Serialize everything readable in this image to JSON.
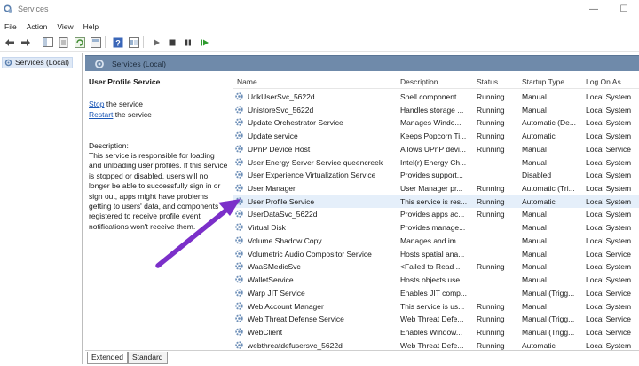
{
  "window": {
    "title": "Services",
    "minimize": "—",
    "restore": "☐"
  },
  "menu": [
    "File",
    "Action",
    "View",
    "Help"
  ],
  "toolbar_icons": [
    "back-icon",
    "forward-icon",
    "show-hide-console-tree-icon",
    "properties-icon",
    "refresh-icon",
    "export-list-icon",
    "help-icon",
    "view-icon",
    "start-icon",
    "stop-icon",
    "pause-icon",
    "restart-icon"
  ],
  "tree": {
    "root": "Services (Local)"
  },
  "header": {
    "title": "Services (Local)"
  },
  "details": {
    "service_name": "User Profile Service",
    "stop_link": "Stop",
    "stop_suffix": " the service",
    "restart_link": "Restart",
    "restart_suffix": " the service",
    "description_label": "Description:",
    "description": "This service is responsible for loading and unloading user profiles. If this service is stopped or disabled, users will no longer be able to successfully sign in or sign out, apps might have problems getting to users' data, and components registered to receive profile event notifications won't receive them."
  },
  "columns": [
    "Name",
    "Description",
    "Status",
    "Startup Type",
    "Log On As"
  ],
  "rows": [
    {
      "name": "UdkUserSvc_5622d",
      "description": "Shell component...",
      "status": "Running",
      "startup": "Manual",
      "logon": "Local System"
    },
    {
      "name": "UnistoreSvc_5622d",
      "description": "Handles storage ...",
      "status": "Running",
      "startup": "Manual",
      "logon": "Local System"
    },
    {
      "name": "Update Orchestrator Service",
      "description": "Manages Windo...",
      "status": "Running",
      "startup": "Automatic (De...",
      "logon": "Local System"
    },
    {
      "name": "Update service",
      "description": "Keeps Popcorn Ti...",
      "status": "Running",
      "startup": "Automatic",
      "logon": "Local System"
    },
    {
      "name": "UPnP Device Host",
      "description": "Allows UPnP devi...",
      "status": "Running",
      "startup": "Manual",
      "logon": "Local Service"
    },
    {
      "name": "User Energy Server Service queencreek",
      "description": "Intel(r) Energy Ch...",
      "status": "",
      "startup": "Manual",
      "logon": "Local System"
    },
    {
      "name": "User Experience Virtualization Service",
      "description": "Provides support...",
      "status": "",
      "startup": "Disabled",
      "logon": "Local System"
    },
    {
      "name": "User Manager",
      "description": "User Manager pr...",
      "status": "Running",
      "startup": "Automatic (Tri...",
      "logon": "Local System"
    },
    {
      "name": "User Profile Service",
      "description": "This service is res...",
      "status": "Running",
      "startup": "Automatic",
      "logon": "Local System"
    },
    {
      "name": "UserDataSvc_5622d",
      "description": "Provides apps ac...",
      "status": "Running",
      "startup": "Manual",
      "logon": "Local System"
    },
    {
      "name": "Virtual Disk",
      "description": "Provides manage...",
      "status": "",
      "startup": "Manual",
      "logon": "Local System"
    },
    {
      "name": "Volume Shadow Copy",
      "description": "Manages and im...",
      "status": "",
      "startup": "Manual",
      "logon": "Local System"
    },
    {
      "name": "Volumetric Audio Compositor Service",
      "description": "Hosts spatial ana...",
      "status": "",
      "startup": "Manual",
      "logon": "Local Service"
    },
    {
      "name": "WaaSMedicSvc",
      "description": "<Failed to Read ...",
      "status": "Running",
      "startup": "Manual",
      "logon": "Local System"
    },
    {
      "name": "WalletService",
      "description": "Hosts objects use...",
      "status": "",
      "startup": "Manual",
      "logon": "Local System"
    },
    {
      "name": "Warp JIT Service",
      "description": "Enables JIT comp...",
      "status": "",
      "startup": "Manual (Trigg...",
      "logon": "Local Service"
    },
    {
      "name": "Web Account Manager",
      "description": "This service is us...",
      "status": "Running",
      "startup": "Manual",
      "logon": "Local System"
    },
    {
      "name": "Web Threat Defense Service",
      "description": "Web Threat Defe...",
      "status": "Running",
      "startup": "Manual (Trigg...",
      "logon": "Local Service"
    },
    {
      "name": "WebClient",
      "description": "Enables Window...",
      "status": "Running",
      "startup": "Manual (Trigg...",
      "logon": "Local Service"
    },
    {
      "name": "webthreatdefusersvc_5622d",
      "description": "Web Threat Defe...",
      "status": "Running",
      "startup": "Automatic",
      "logon": "Local System"
    }
  ],
  "selected_row": "User Profile Service",
  "tabs": [
    "Extended",
    "Standard"
  ],
  "colors": {
    "header_strip": "#6f8aaa",
    "selection": "#e5effa",
    "link": "#1a56b6",
    "annotation_arrow": "#7b2fc9"
  }
}
